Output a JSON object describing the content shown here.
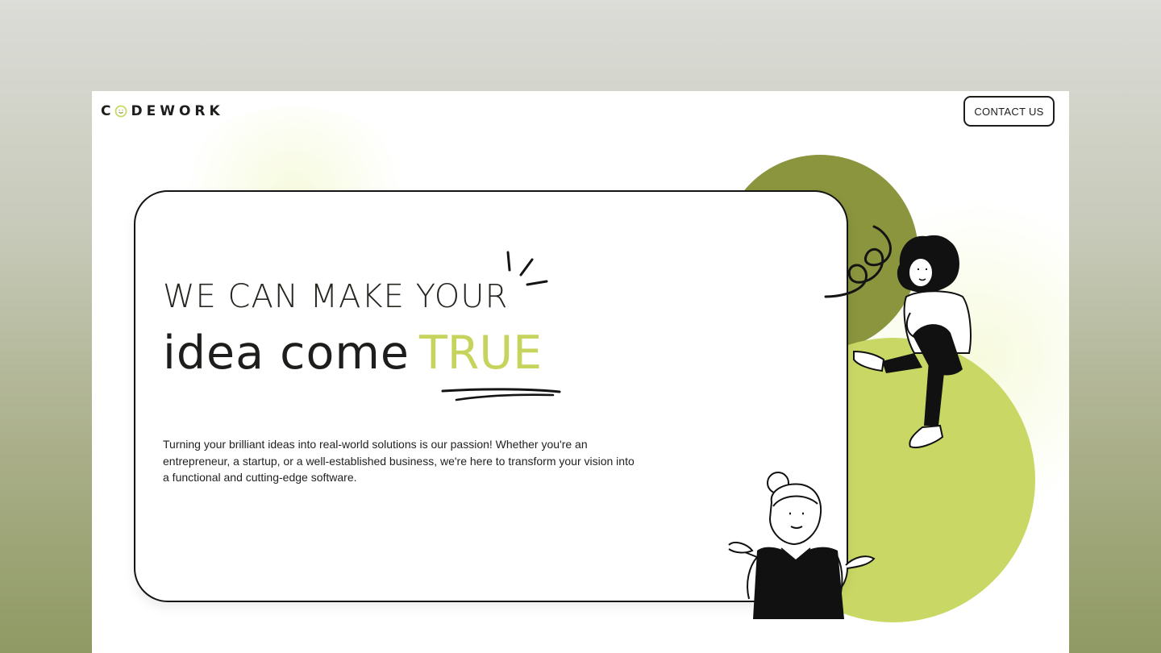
{
  "brand": {
    "logo_text": "CODEWORK"
  },
  "header": {
    "contact_label": "CONTACT US"
  },
  "hero": {
    "headline_line1": "WE CAN MAKE YOUR",
    "headline_line2": "idea come",
    "headline_accent": "TRUE",
    "description": "Turning your brilliant ideas into real-world solutions is our passion! Whether you're an entrepreneur, a startup, or a well-established business, we're here to transform your vision into a functional and cutting-edge software."
  },
  "colors": {
    "accent_lime": "#c9d865",
    "accent_olive": "#8a953d",
    "ink": "#1d1d1b"
  },
  "icons": [
    "logo-o-mark-icon",
    "sparkle-lines-icon",
    "brush-underline-icon",
    "scribble-icon"
  ]
}
